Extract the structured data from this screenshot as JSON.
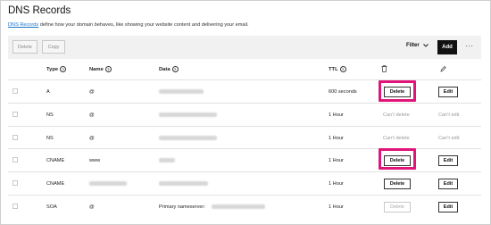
{
  "page": {
    "title": "DNS Records",
    "desc_link": "DNS Records",
    "desc_rest": " define how your domain behaves, like showing your website content and delivering your email."
  },
  "toolbar": {
    "delete_label": "Delete",
    "copy_label": "Copy",
    "filter_label": "Filter",
    "add_label": "Add",
    "more_label": "···"
  },
  "columns": {
    "type": "Type",
    "name": "Name",
    "data": "Data",
    "ttl": "TTL"
  },
  "rows": [
    {
      "type": "A",
      "name": "@",
      "data": "",
      "ttl": "600 seconds",
      "delete": "Delete",
      "edit": "Edit",
      "deletable": true,
      "editable": true
    },
    {
      "type": "NS",
      "name": "@",
      "data": "",
      "ttl": "1 Hour",
      "delete": "Can't delete",
      "edit": "Can't edit",
      "deletable": false,
      "editable": false
    },
    {
      "type": "NS",
      "name": "@",
      "data": "",
      "ttl": "1 Hour",
      "delete": "Can't delete",
      "edit": "Can't edit",
      "deletable": false,
      "editable": false
    },
    {
      "type": "CNAME",
      "name": "www",
      "data": "",
      "ttl": "1 Hour",
      "delete": "Delete",
      "edit": "Edit",
      "deletable": true,
      "editable": true
    },
    {
      "type": "CNAME",
      "name": "",
      "data": "",
      "ttl": "1 Hour",
      "delete": "Delete",
      "edit": "Edit",
      "deletable": true,
      "editable": true
    },
    {
      "type": "SOA",
      "name": "@",
      "data": "Primary nameserver:",
      "ttl": "1 Hour",
      "delete": "Delete",
      "edit": "Edit",
      "deletable": false,
      "editable": true
    }
  ],
  "icons": {
    "trash": "trash-icon",
    "pencil": "pencil-icon",
    "info": "info-icon",
    "chevron": "chevron-down-icon"
  },
  "colors": {
    "highlight": "#e0157a",
    "link": "#1a73c8",
    "add_bg": "#111111"
  }
}
